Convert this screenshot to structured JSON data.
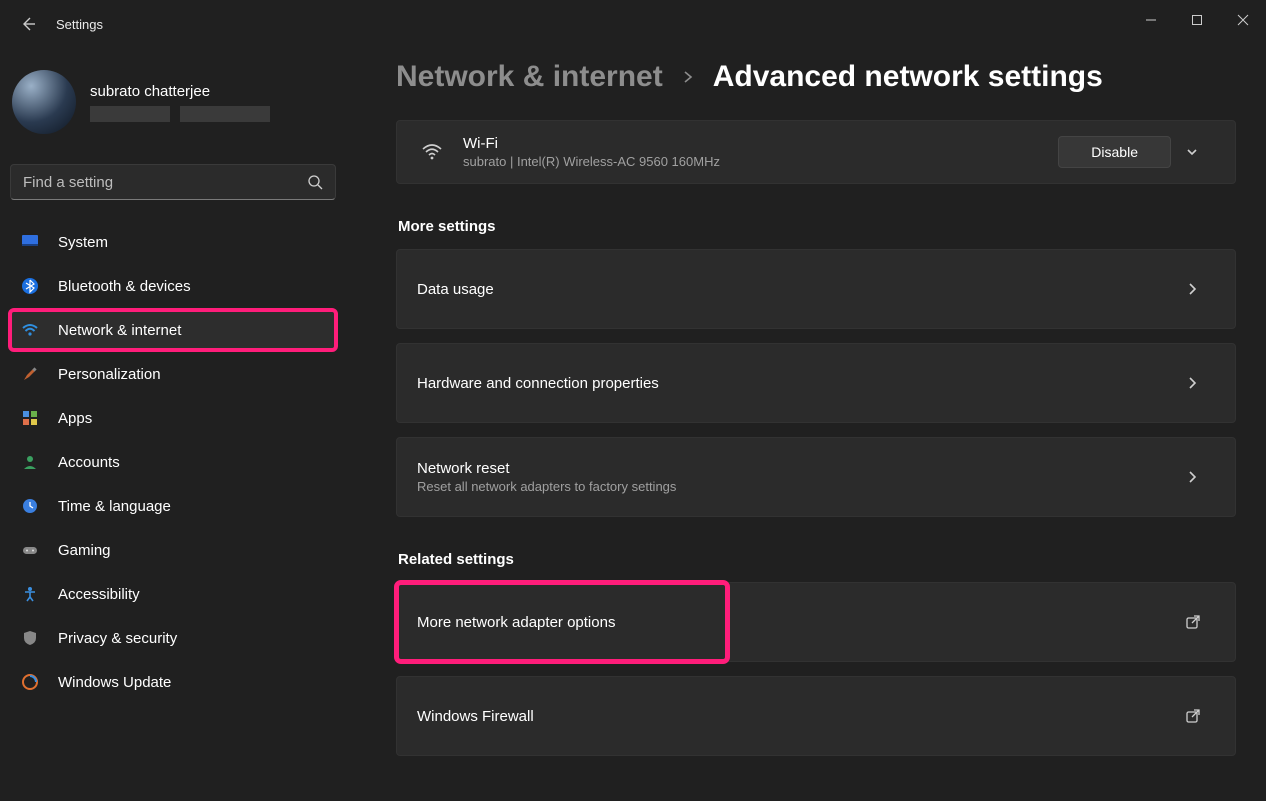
{
  "window": {
    "title": "Settings"
  },
  "profile": {
    "name": "subrato chatterjee"
  },
  "search": {
    "placeholder": "Find a setting"
  },
  "sidebar": {
    "items": [
      {
        "label": "System"
      },
      {
        "label": "Bluetooth & devices"
      },
      {
        "label": "Network & internet"
      },
      {
        "label": "Personalization"
      },
      {
        "label": "Apps"
      },
      {
        "label": "Accounts"
      },
      {
        "label": "Time & language"
      },
      {
        "label": "Gaming"
      },
      {
        "label": "Accessibility"
      },
      {
        "label": "Privacy & security"
      },
      {
        "label": "Windows Update"
      }
    ]
  },
  "breadcrumb": {
    "parent": "Network & internet",
    "title": "Advanced network settings"
  },
  "wifi": {
    "title": "Wi-Fi",
    "detail": "subrato | Intel(R) Wireless-AC 9560 160MHz",
    "action": "Disable"
  },
  "sections": {
    "more": "More settings",
    "related": "Related settings"
  },
  "more_items": {
    "data_usage": "Data usage",
    "hw_props": "Hardware and connection properties",
    "reset_title": "Network reset",
    "reset_sub": "Reset all network adapters to factory settings"
  },
  "related_items": {
    "adapter": "More network adapter options",
    "firewall": "Windows Firewall"
  }
}
